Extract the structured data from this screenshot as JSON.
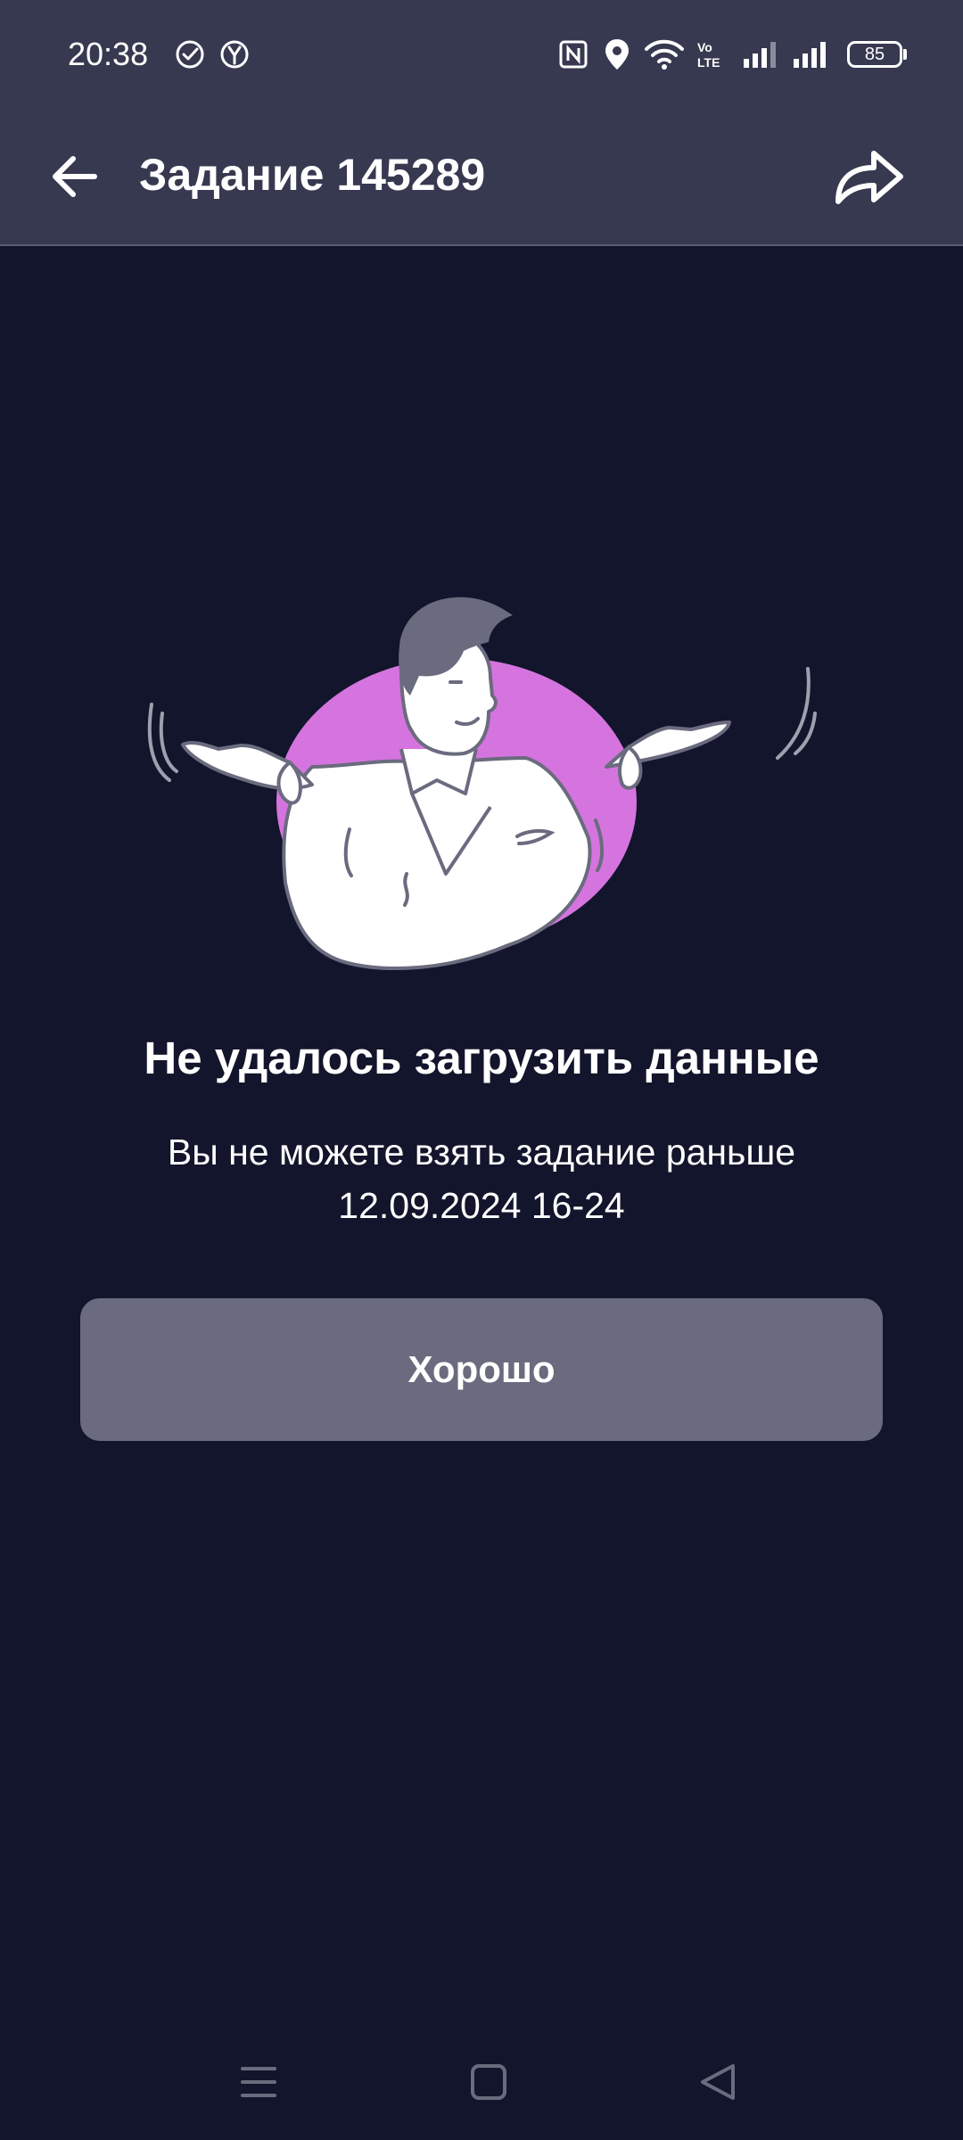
{
  "status_bar": {
    "time": "20:38",
    "battery_level": "85",
    "icons": [
      "check-circle-icon",
      "yandex-icon",
      "nfc-icon",
      "location-icon",
      "wifi-icon",
      "volte-icon",
      "signal-icon",
      "signal-icon",
      "battery-icon"
    ]
  },
  "app_bar": {
    "title": "Задание 145289",
    "back_icon": "arrow-left-icon",
    "share_icon": "share-icon"
  },
  "content": {
    "illustration": "shrugging-man-illustration",
    "error_title": "Не удалось загрузить данные",
    "error_message": "Вы не можете взять задание раньше 12.09.2024 16-24",
    "ok_button_label": "Хорошо"
  },
  "nav_bar": {
    "icons": [
      "menu-icon",
      "home-icon",
      "back-triangle-icon"
    ]
  },
  "colors": {
    "background": "#12152b",
    "app_bar": "#363950",
    "button": "#6a6b7e",
    "blob": "#d574df",
    "text": "#ffffff"
  }
}
